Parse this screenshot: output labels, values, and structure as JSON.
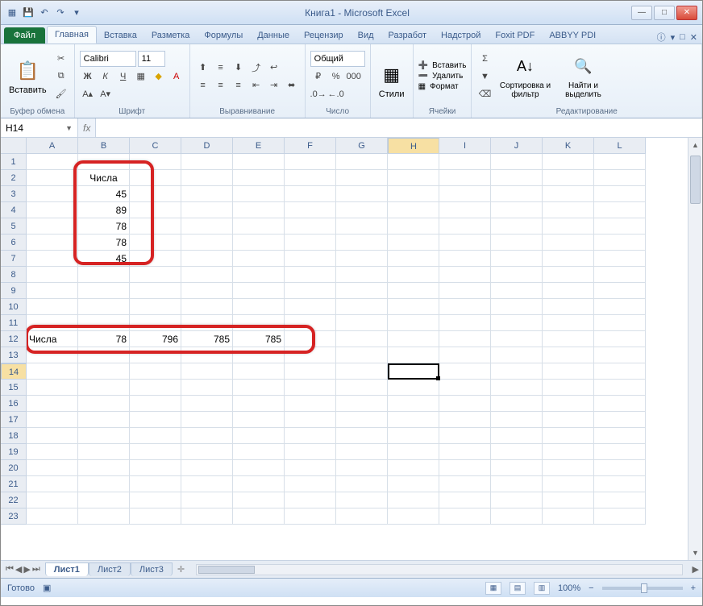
{
  "title": "Книга1 - Microsoft Excel",
  "tabs": {
    "file": "Файл",
    "home": "Главная",
    "insert": "Вставка",
    "layout": "Разметка",
    "formulas": "Формулы",
    "data": "Данные",
    "review": "Рецензир",
    "view": "Вид",
    "dev": "Разработ",
    "addins": "Надстрой",
    "foxit": "Foxit PDF",
    "abbyy": "ABBYY PDI"
  },
  "ribbon": {
    "clipboard": {
      "paste": "Вставить",
      "label": "Буфер обмена"
    },
    "font": {
      "name": "Calibri",
      "size": "11",
      "label": "Шрифт"
    },
    "align": {
      "label": "Выравнивание"
    },
    "number": {
      "format": "Общий",
      "label": "Число"
    },
    "styles": {
      "btn": "Стили",
      "label": ""
    },
    "cells": {
      "insert": "Вставить",
      "delete": "Удалить",
      "format": "Формат",
      "label": "Ячейки"
    },
    "editing": {
      "sort": "Сортировка и фильтр",
      "find": "Найти и выделить",
      "label": "Редактирование"
    }
  },
  "namebox": "H14",
  "columns": [
    "A",
    "B",
    "C",
    "D",
    "E",
    "F",
    "G",
    "H",
    "I",
    "J",
    "K",
    "L"
  ],
  "rows_count": 23,
  "cells": {
    "B2": "Числа",
    "B3": "45",
    "B4": "89",
    "B5": "78",
    "B6": "78",
    "B7": "45",
    "A12": "Числа",
    "B12": "78",
    "C12": "796",
    "D12": "785",
    "E12": "785"
  },
  "selected_cell": {
    "col": "H",
    "row": 14
  },
  "sheets": [
    "Лист1",
    "Лист2",
    "Лист3"
  ],
  "status": {
    "ready": "Готово",
    "zoom": "100%"
  }
}
